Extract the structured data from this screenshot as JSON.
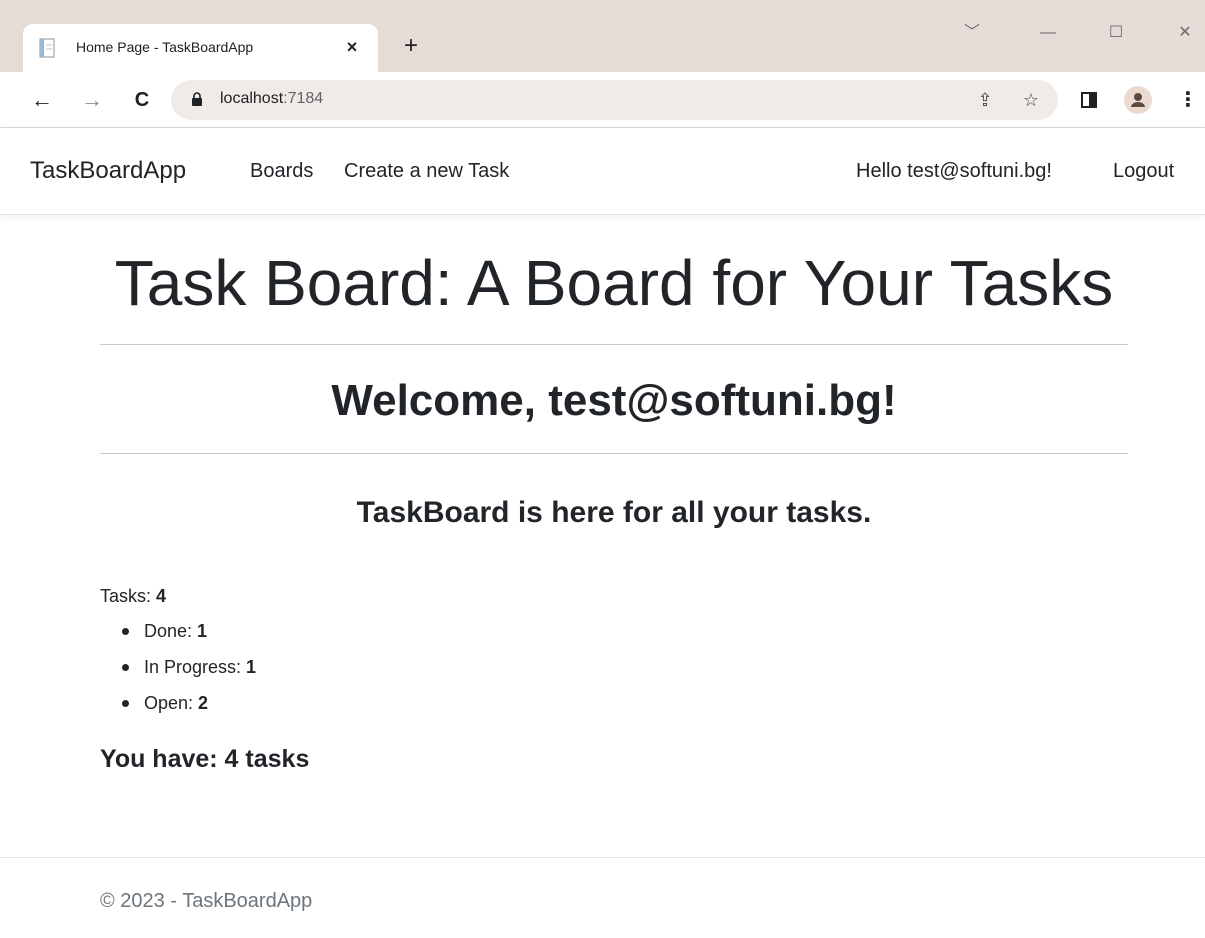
{
  "browser": {
    "tab_title": "Home Page - TaskBoardApp",
    "tab_close": "×",
    "new_tab": "+",
    "url_host": "localhost",
    "url_port": ":7184",
    "window_minimize": "—",
    "window_maximize": "☐",
    "window_close": "✕",
    "tab_search": "﹀",
    "back": "←",
    "forward": "→",
    "reload": "C",
    "share_icon": "⇪",
    "bookmark_star": "☆",
    "menu": "⋮"
  },
  "navbar": {
    "brand": "TaskBoardApp",
    "links": [
      "Boards",
      "Create a new Task"
    ],
    "greeting": "Hello test@softuni.bg!",
    "logout": "Logout"
  },
  "main": {
    "title": "Task Board: A Board for Your Tasks",
    "welcome": "Welcome, test@softuni.bg!",
    "tagline": "TaskBoard is here for all your tasks.",
    "tasks_label": "Tasks: ",
    "tasks_count": "4",
    "stats": [
      {
        "label": "Done: ",
        "value": "1"
      },
      {
        "label": "In Progress: ",
        "value": "1"
      },
      {
        "label": "Open: ",
        "value": "2"
      }
    ],
    "summary": "You have: 4 tasks"
  },
  "footer": {
    "text": "© 2023 - TaskBoardApp"
  }
}
